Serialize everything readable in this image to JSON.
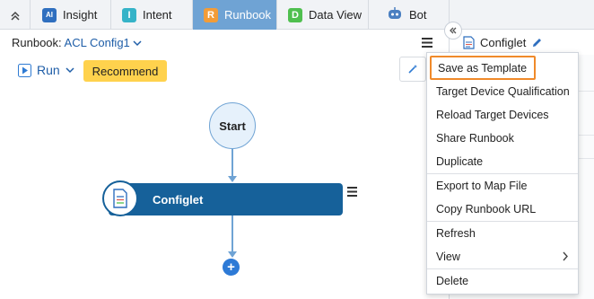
{
  "tabs": [
    {
      "label": "Insight",
      "icon": "ai-icon",
      "color": "#2f6fbf"
    },
    {
      "label": "Intent",
      "icon": "intent-icon",
      "letter": "I",
      "color": "#35b3c8"
    },
    {
      "label": "Runbook",
      "icon": "runbook-icon",
      "letter": "R",
      "color": "#f29c38",
      "active": true
    },
    {
      "label": "Data View",
      "icon": "dataview-icon",
      "letter": "D",
      "color": "#4fbf4f"
    },
    {
      "label": "Bot",
      "icon": "bot-icon",
      "color": "#4a7fc1"
    }
  ],
  "header": {
    "runbook_prefix": "Runbook: ",
    "runbook_name": "ACL Config1"
  },
  "right_panel": {
    "title": "Configlet"
  },
  "toolbar": {
    "run_label": "Run",
    "recommend_label": "Recommend"
  },
  "flow": {
    "start_label": "Start",
    "node_label": "Configlet"
  },
  "menu": {
    "items": [
      "Save as Template",
      "Target Device Qualification",
      "Reload Target Devices",
      "Share Runbook",
      "Duplicate",
      "Export to Map File",
      "Copy Runbook URL",
      "Refresh",
      "View",
      "Delete"
    ]
  },
  "colors": {
    "accent": "#1f5ea8",
    "active_tab": "#6fa3d4",
    "node": "#16619a",
    "recommend": "#ffd24d",
    "highlight": "#f08a2a"
  }
}
